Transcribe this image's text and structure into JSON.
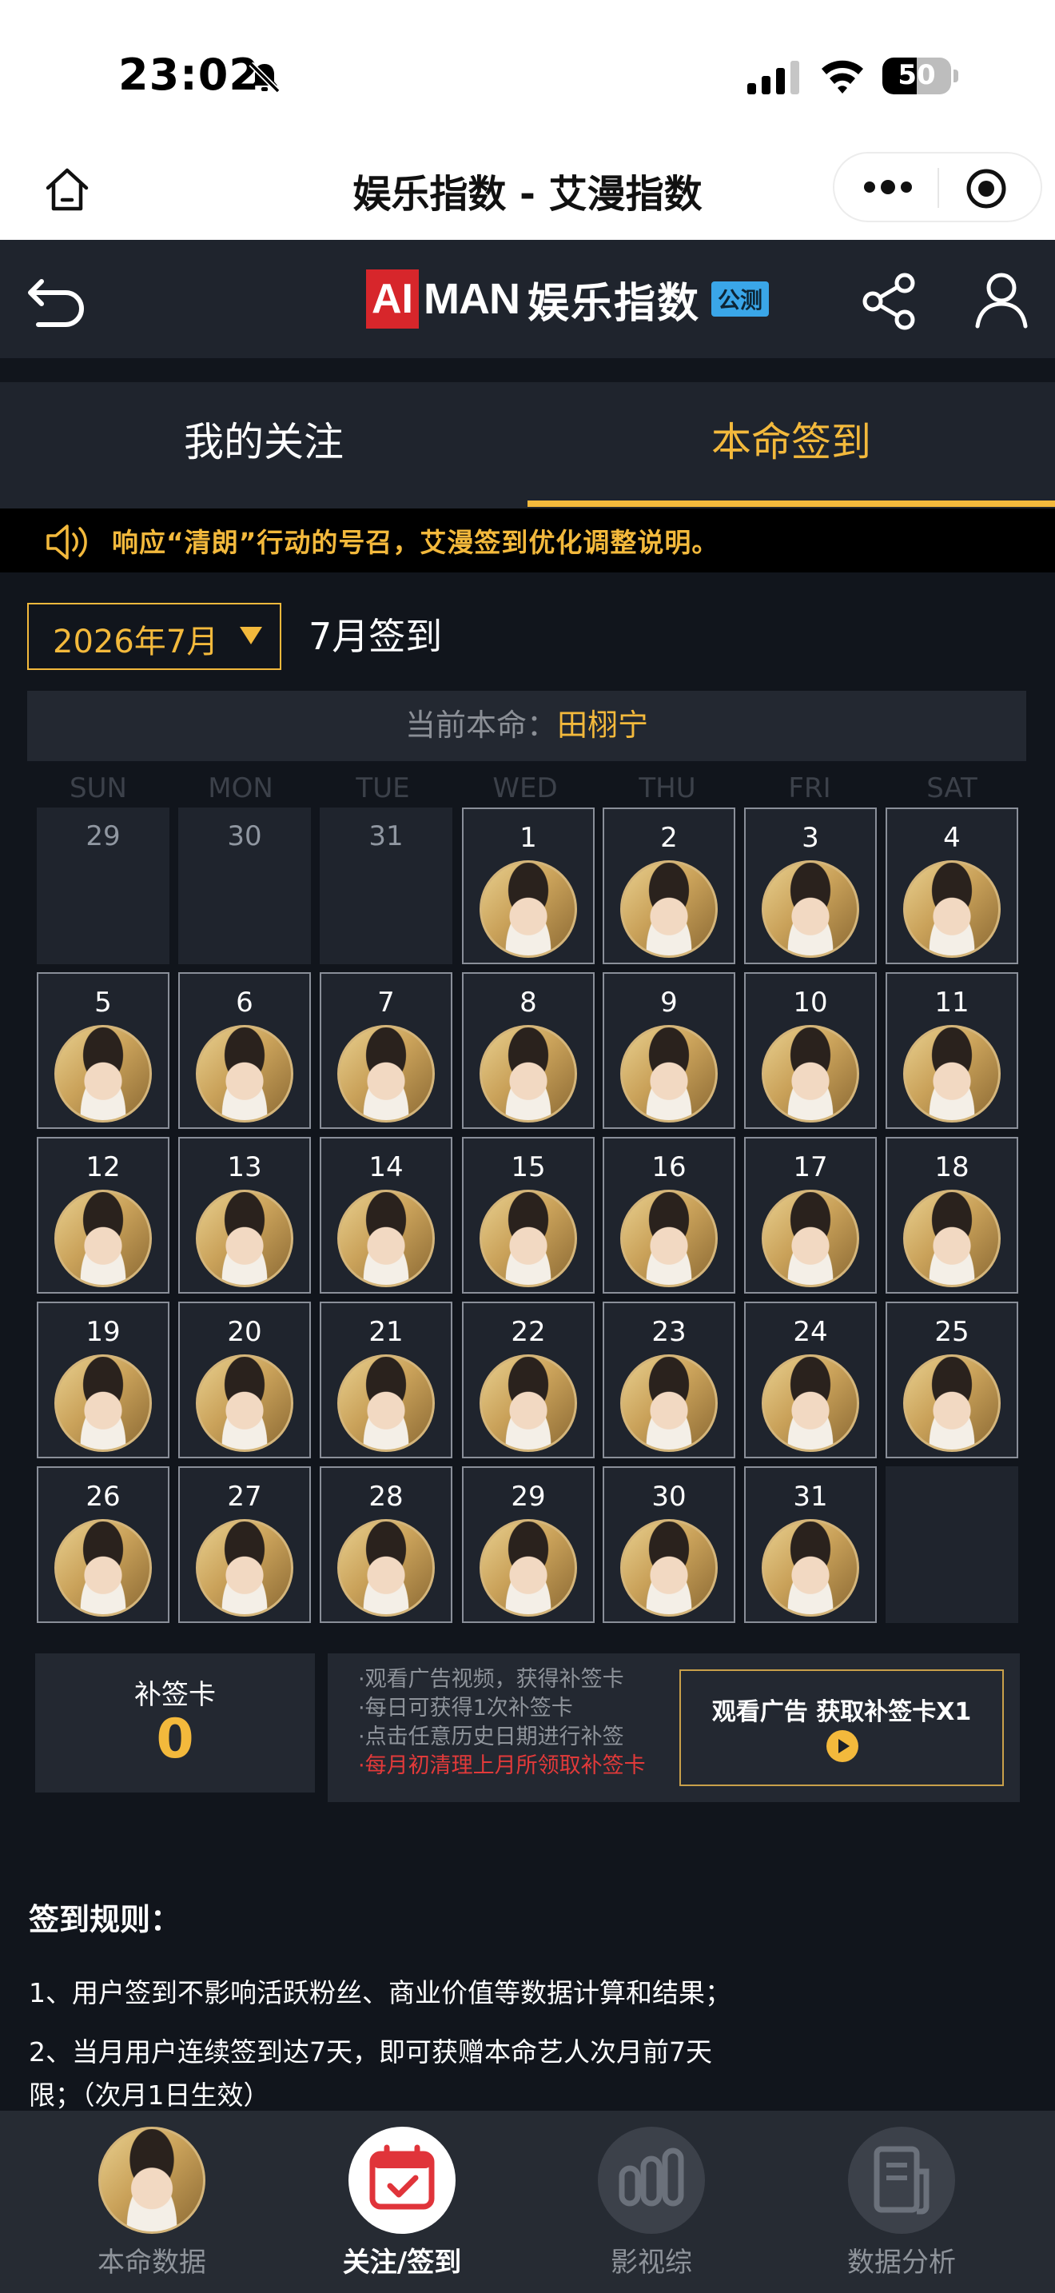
{
  "status_bar": {
    "time": "23:02",
    "battery_level": "50",
    "battery_fraction": 0.5
  },
  "mini_program": {
    "title": "娱乐指数 - 艾漫指数"
  },
  "app_header": {
    "logo_ai": "AI",
    "logo_man": "MAN",
    "logo_cn": "娱乐指数",
    "beta_badge": "公测"
  },
  "tabs": [
    {
      "label": "我的关注"
    },
    {
      "label": "本命签到"
    }
  ],
  "notice": {
    "text": "响应“清朗”行动的号召，艾漫签到优化调整说明。"
  },
  "month": {
    "selected": "2026年7月",
    "title": "7月签到"
  },
  "current_idol": {
    "label": "当前本命：",
    "name": "田栩宁"
  },
  "calendar": {
    "weekdays": [
      "SUN",
      "MON",
      "TUE",
      "WED",
      "THU",
      "FRI",
      "SAT"
    ],
    "leading_days": [
      "29",
      "30",
      "31"
    ],
    "days": [
      "1",
      "2",
      "3",
      "4",
      "5",
      "6",
      "7",
      "8",
      "9",
      "10",
      "11",
      "12",
      "13",
      "14",
      "15",
      "16",
      "17",
      "18",
      "19",
      "20",
      "21",
      "22",
      "23",
      "24",
      "25",
      "26",
      "27",
      "28",
      "29",
      "30",
      "31"
    ]
  },
  "makeup_card": {
    "label": "补签卡",
    "count": "0",
    "tips": [
      "·观看广告视频，获得补签卡",
      "·每日可获得1次补签卡",
      "·点击任意历史日期进行补签",
      "·每月初清理上月所领取补签卡"
    ],
    "ad_button": "观看广告 获取补签卡X1"
  },
  "rules": {
    "title": "签到规则：",
    "items": [
      "1、用户签到不影响活跃粉丝、商业价值等数据计算和结果；",
      "2、当月用户连续签到达7天，即可获赠本命艺人次月前7天",
      "限；（次月1日生效）"
    ]
  },
  "bottom_nav": [
    {
      "label": "本命数据"
    },
    {
      "label": "关注/签到"
    },
    {
      "label": "影视综"
    },
    {
      "label": "数据分析"
    }
  ],
  "colors": {
    "accent": "#f3b93c",
    "background": "#11151c",
    "panel": "#1f242d",
    "warning": "#e23a3a"
  }
}
